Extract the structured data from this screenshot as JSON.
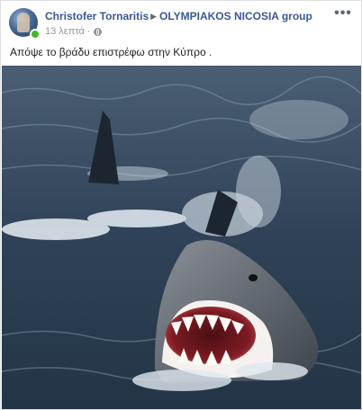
{
  "post": {
    "author": "Christofer Tornaritis",
    "group": "OLYMPIAKOS NICOSIA group",
    "time": "13 λεπτά",
    "time_separator": "·",
    "privacy_icon": "globe-icon",
    "text": "Απόψε το βράδυ επιστρέφω στην Κύπρο .",
    "more_icon": "more-options-icon",
    "online": true,
    "colors": {
      "link": "#385898",
      "meta": "#90949c",
      "online": "#42b72a",
      "water": "#3b4f64"
    }
  }
}
